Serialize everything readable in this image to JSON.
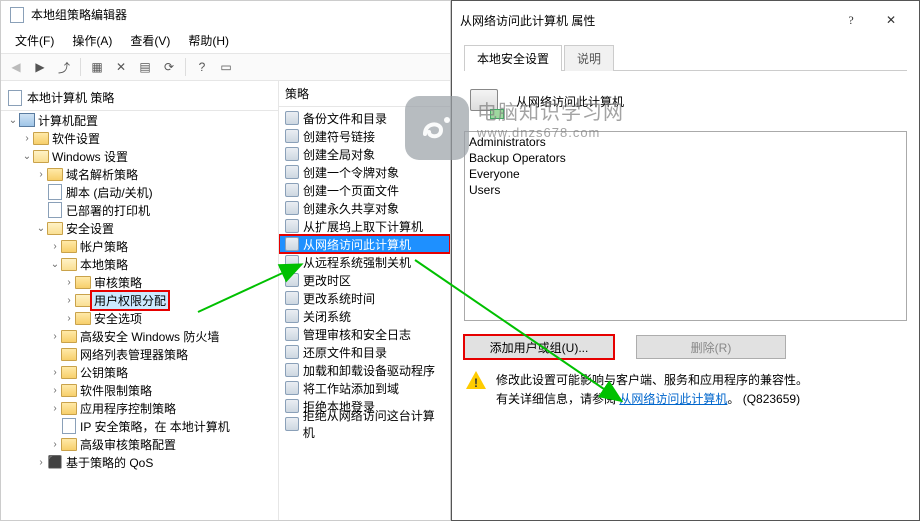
{
  "mmc": {
    "title": "本地组策略编辑器",
    "menu": {
      "file": "文件(F)",
      "action": "操作(A)",
      "view": "查看(V)",
      "help": "帮助(H)"
    },
    "tree_header": "本地计算机 策略",
    "list_header": "策略",
    "tree": {
      "root": "本地计算机 策略",
      "computer_config": "计算机配置",
      "software_settings": "软件设置",
      "windows_settings": "Windows 设置",
      "name_res": "域名解析策略",
      "scripts": "脚本 (启动/关机)",
      "printers": "已部署的打印机",
      "security": "安全设置",
      "account_policies": "帐户策略",
      "local_policies": "本地策略",
      "audit_policy": "审核策略",
      "user_rights": "用户权限分配",
      "security_options": "安全选项",
      "advanced_fw": "高级安全 Windows 防火墙",
      "nlm": "网络列表管理器策略",
      "public_key": "公钥策略",
      "soft_restrict": "软件限制策略",
      "app_control": "应用程序控制策略",
      "ipsec": "IP 安全策略，在 本地计算机",
      "adv_audit": "高级审核策略配置",
      "qos": "基于策略的 QoS"
    },
    "policies": [
      "备份文件和目录",
      "创建符号链接",
      "创建全局对象",
      "创建一个令牌对象",
      "创建一个页面文件",
      "创建永久共享对象",
      "从扩展坞上取下计算机",
      "从网络访问此计算机",
      "从远程系统强制关机",
      "更改时区",
      "更改系统时间",
      "关闭系统",
      "管理审核和安全日志",
      "还原文件和目录",
      "加载和卸载设备驱动程序",
      "将工作站添加到域",
      "拒绝本地登录",
      "拒绝从网络访问这台计算机"
    ]
  },
  "dialog": {
    "title": "从网络访问此计算机 属性",
    "tab1": "本地安全设置",
    "tab2": "说明",
    "heading": "从网络访问此计算机",
    "members": [
      "Administrators",
      "Backup Operators",
      "Everyone",
      "Users"
    ],
    "btn_add": "添加用户或组(U)...",
    "btn_remove": "删除(R)",
    "warn_line1": "修改此设置可能影响与客户端、服务和应用程序的兼容性。",
    "warn_line2a": "有关详细信息，请参阅",
    "warn_link": "从网络访问此计算机",
    "warn_line2b": "。 (Q823659)"
  },
  "watermark": {
    "l1": "电脑知识学习网",
    "l2": "www.dnzs678.com"
  }
}
